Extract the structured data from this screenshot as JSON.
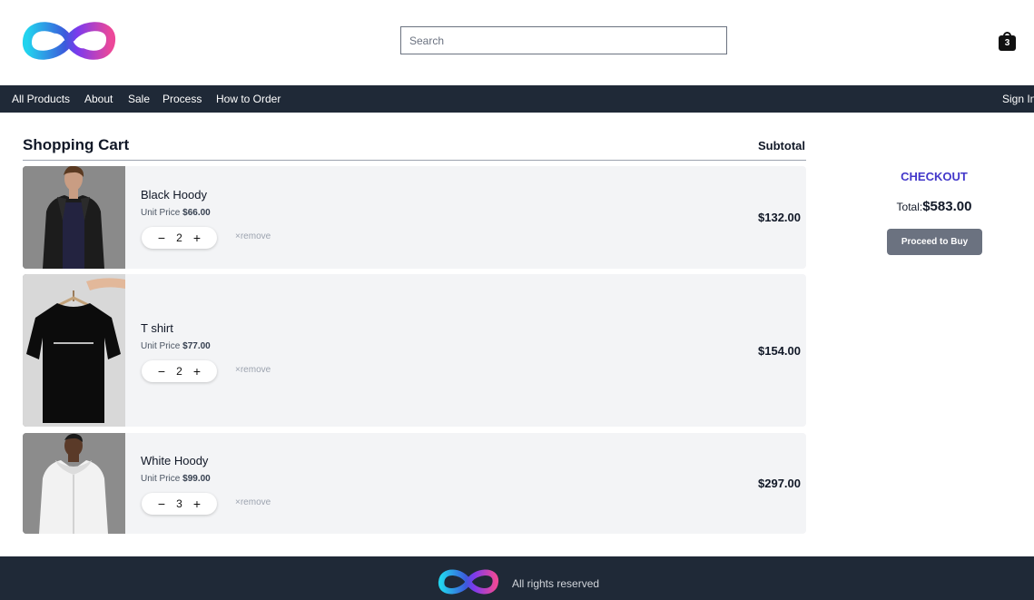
{
  "header": {
    "logo_name": "infinity-logo",
    "search_placeholder": "Search",
    "cart_count": "3"
  },
  "nav": {
    "items": [
      "All Products",
      "About",
      "Sale",
      "Process",
      "How to Order"
    ],
    "sign_in": "Sign In"
  },
  "cart": {
    "title": "Shopping Cart",
    "subtotal_label": "Subtotal",
    "unit_price_label": "Unit Price",
    "remove_label": "remove",
    "remove_icon": "×",
    "items": [
      {
        "name": "Black Hoody",
        "unit_price": "$66.00",
        "quantity": "2",
        "subtotal": "$132.00"
      },
      {
        "name": "T shirt",
        "unit_price": "$77.00",
        "quantity": "2",
        "subtotal": "$154.00"
      },
      {
        "name": "White Hoody",
        "unit_price": "$99.00",
        "quantity": "3",
        "subtotal": "$297.00"
      }
    ]
  },
  "checkout": {
    "title": "CHECKOUT",
    "total_label": "Total:",
    "total_value": "$583.00",
    "button_label": "Proceed to Buy"
  },
  "footer": {
    "text": "All rights reserved"
  },
  "colors": {
    "nav_bg": "#1f2937",
    "checkout_accent": "#4338ca",
    "button_bg": "#6b7280",
    "row_bg": "#f3f4f6"
  }
}
